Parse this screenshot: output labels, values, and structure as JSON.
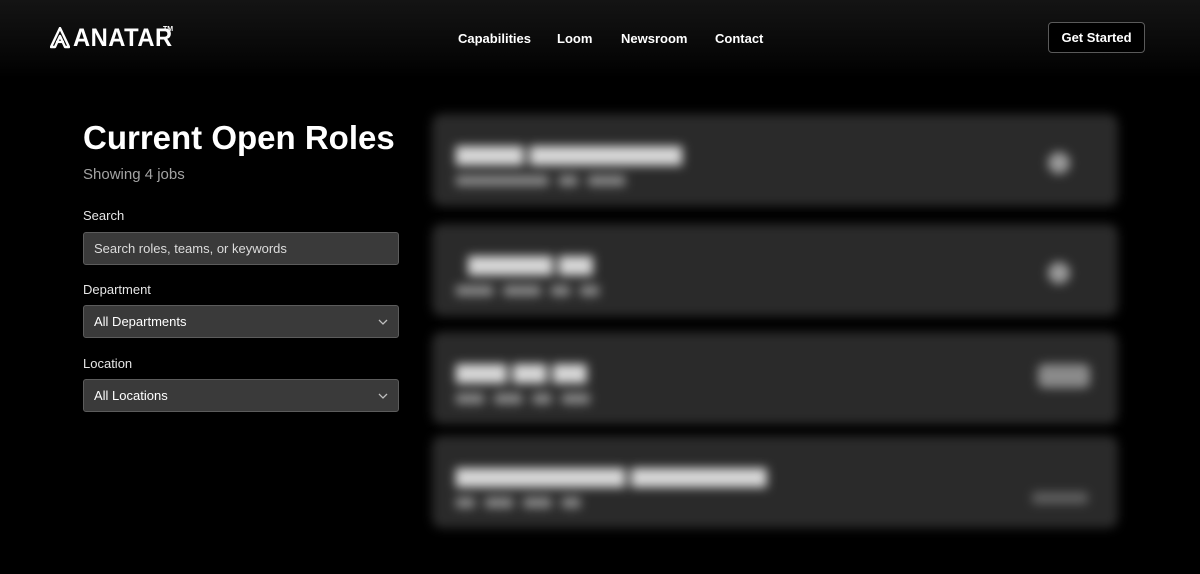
{
  "header": {
    "brand": "ANATAR",
    "brand_mark": "TM",
    "nav": [
      "Capabilities",
      "Loom",
      "Newsroom",
      "Contact"
    ],
    "cta_label": "Get Started"
  },
  "main": {
    "title": "Current Open Roles",
    "count_text": "Showing 4 jobs"
  },
  "filters": {
    "search_label": "Search",
    "search_placeholder": "Search roles, teams, or keywords",
    "department_label": "Department",
    "department_value": "All Departments",
    "location_label": "Location",
    "location_value": "All Locations"
  }
}
